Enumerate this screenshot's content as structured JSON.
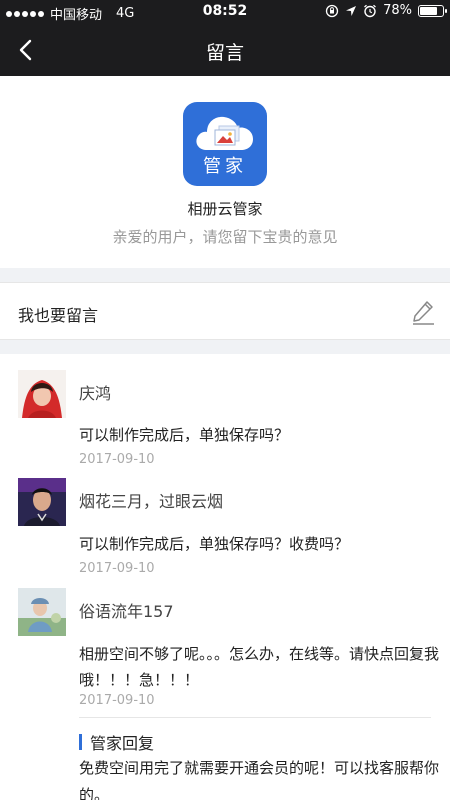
{
  "status_bar": {
    "carrier": "中国移动",
    "network": "4G",
    "time": "08:52",
    "battery_percent": "78%",
    "battery_level": 0.78
  },
  "nav": {
    "title": "留言"
  },
  "header": {
    "logo_text": "管家",
    "app_name": "相册云管家",
    "subtitle": "亲爱的用户，请您留下宝贵的意见"
  },
  "write_prompt": "我也要留言",
  "comments": [
    {
      "user": "庆鸿",
      "text": "可以制作完成后，单独保存吗？",
      "date": "2017-09-10"
    },
    {
      "user": "烟花三月，过眼云烟",
      "text": "可以制作完成后，单独保存吗？收费吗？",
      "date": "2017-09-10"
    },
    {
      "user": "俗语流年157",
      "text": "相册空间不够了呢。。。怎么办，在线等。请快点回复我哦！！！急！！！",
      "date": "2017-09-10",
      "reply_title": "管家回复",
      "reply_text": "免费空间用完了就需要开通会员的呢！可以找客服帮你的。"
    }
  ],
  "colors": {
    "bar": "#1c1c1e",
    "accent": "#2f6fd8",
    "divider_bg": "#f0f2f5"
  }
}
